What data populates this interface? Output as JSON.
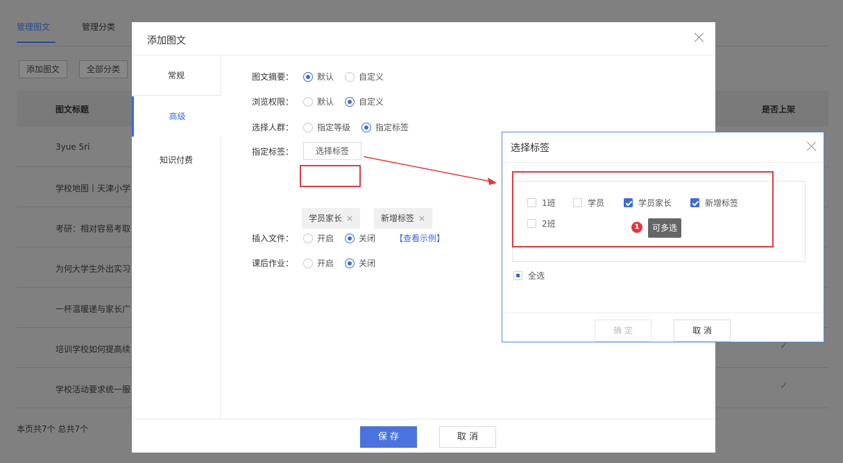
{
  "bg": {
    "tabs": [
      "管理图文",
      "管理分类"
    ],
    "buttons": [
      "添加图文",
      "全部分类"
    ],
    "headers": {
      "title": "图文标题",
      "status": "是否上架"
    },
    "rows": [
      "3yue 5ri",
      "学校地图丨天津小学",
      "考研：相对容易考取",
      "为何大学生外出实习",
      "一杯温暖递与家长广",
      "培训学校如何提高续",
      "学校活动要求统一服"
    ],
    "footer": "本页共7个 总共7个"
  },
  "modal": {
    "title": "添加图文",
    "nav": [
      "常规",
      "高级",
      "知识付费"
    ],
    "form": {
      "summary": {
        "label": "图文摘要：",
        "opt1": "默认",
        "opt2": "自定义"
      },
      "permission": {
        "label": "浏览权限：",
        "opt1": "默认",
        "opt2": "自定义"
      },
      "audience": {
        "label": "选择人群：",
        "opt1": "指定等级",
        "opt2": "指定标签"
      },
      "tags": {
        "label": "指定标签：",
        "button": "选择标签",
        "items": [
          "学员家长",
          "新增标签"
        ]
      },
      "file": {
        "label": "插入文件：",
        "opt1": "开启",
        "opt2": "关闭",
        "link": "【查看示例】"
      },
      "homework": {
        "label": "课后作业：",
        "opt1": "开启",
        "opt2": "关闭"
      }
    },
    "save": "保 存",
    "cancel": "取 消"
  },
  "picker": {
    "title": "选择标签",
    "options": [
      "1班",
      "学员",
      "学员家长",
      "新增标签",
      "2班"
    ],
    "tooltip": "可多选",
    "badge": "1",
    "select_all": "全选",
    "ok": "确 定",
    "cancel": "取 消"
  },
  "colors": {
    "accent": "#3a6bd8",
    "highlight": "#e0393e"
  }
}
